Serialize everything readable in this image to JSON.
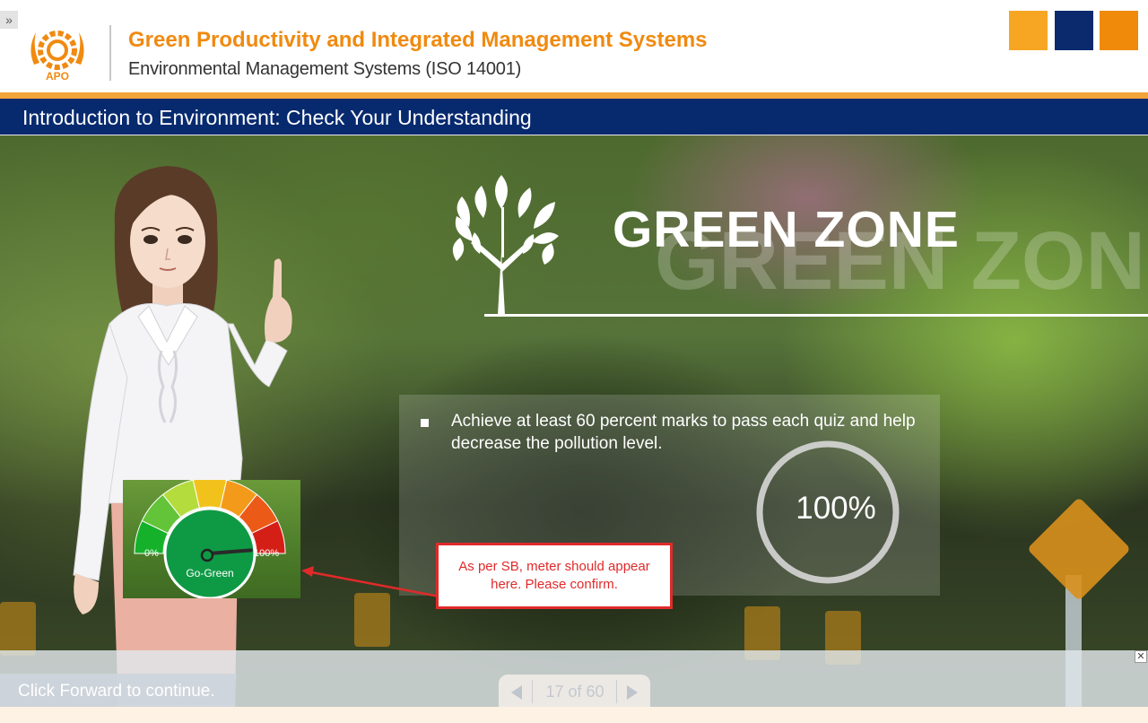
{
  "header": {
    "menu_toggle": "»",
    "course_title": "Green Productivity and Integrated Management Systems",
    "course_subtitle": "Environmental Management Systems (ISO 14001)",
    "logo_text": "APO",
    "theme_swatches": [
      "#f6a623",
      "#0b2a6e",
      "#ef8a0b"
    ]
  },
  "title_bar": {
    "title": "Introduction to Environment: Check Your Understanding"
  },
  "slide": {
    "heading": "GREEN ZONE",
    "heading_shadow": "GREEN ZON",
    "instruction": "Achieve at least 60 percent marks to pass each quiz and help decrease the pollution level.",
    "progress_label": "100%",
    "progress_fraction": 1.0
  },
  "gauge": {
    "min_label": "0%",
    "max_label": "100%",
    "center_label": "Go-Green",
    "value_fraction": 1.0
  },
  "review_note": {
    "text": "As per SB, meter should appear here. Please confirm."
  },
  "bottom_bar": {
    "continue_hint": "Click Forward to continue.",
    "page_counter": "17 of 60",
    "close_symbol": "✕"
  },
  "colors": {
    "accent_orange": "#f08a10",
    "navy": "#072a6f",
    "review_red": "#e02a2a"
  }
}
